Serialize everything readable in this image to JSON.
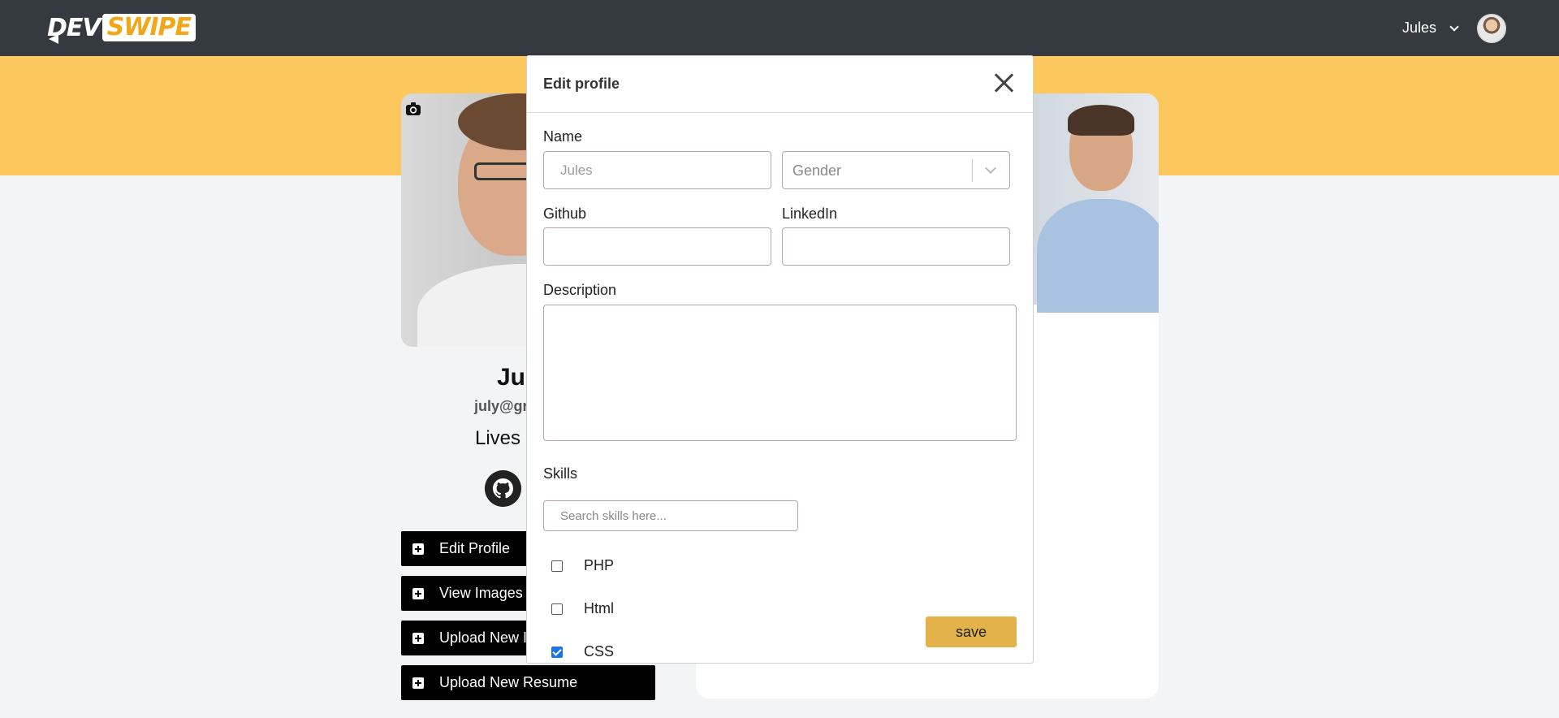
{
  "navbar": {
    "logo_dev": "DEV",
    "logo_swipe": "SWIPE",
    "username": "Jules"
  },
  "profile": {
    "name": "Ju",
    "email": "july@gr",
    "lives": "Lives i"
  },
  "side_buttons": [
    {
      "label": "Edit Profile"
    },
    {
      "label": "View Images"
    },
    {
      "label": "Upload New I"
    },
    {
      "label": "Upload New Resume"
    }
  ],
  "modal": {
    "title": "Edit profile",
    "name_label": "Name",
    "name_placeholder": "Jules",
    "gender_placeholder": "Gender",
    "github_label": "Github",
    "linkedin_label": "LinkedIn",
    "description_label": "Description",
    "skills_label": "Skills",
    "skills_search_placeholder": "Search skills here...",
    "skills": [
      {
        "name": "PHP",
        "checked": false
      },
      {
        "name": "Html",
        "checked": false
      },
      {
        "name": "CSS",
        "checked": true
      }
    ],
    "save_label": "save"
  },
  "colors": {
    "navbar": "#343a40",
    "banner": "#fcc85e",
    "save_button": "#e3b24b",
    "checkbox_checked": "#1a73e8"
  }
}
